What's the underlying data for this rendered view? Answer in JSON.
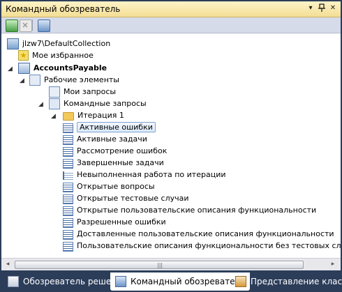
{
  "window": {
    "title": "Командный обозреватель",
    "controls": {
      "dropdown": "▾",
      "pin": "ᵖ",
      "close": "✕"
    }
  },
  "toolbar": {
    "buttons": [
      {
        "icon": "refresh-icon"
      },
      {
        "icon": "stop-icon"
      },
      {
        "icon": "connect-to-team-project-icon"
      }
    ]
  },
  "tree": {
    "server": "jlzw7\\DefaultCollection",
    "favorites": "Мое избранное",
    "project": "AccountsPayable",
    "work_items": "Рабочие элементы",
    "my_queries": "Мои запросы",
    "team_queries": "Командные запросы",
    "iteration_folder": "Итерация 1",
    "queries": [
      "Активные ошибки",
      "Активные задачи",
      "Рассмотрение ошибок",
      "Завершенные задачи",
      "Невыполненная работа по итерации",
      "Открытые вопросы",
      "Открытые тестовые случаи",
      "Открытые пользовательские описания функциональности",
      "Разрешенные ошибки",
      "Доставленные пользовательские описания функциональности",
      "Пользовательские описания функциональности без тестовых случаев"
    ],
    "selected_query": "Активные ошибки"
  },
  "scrollbar": {
    "left_arrow": "◂",
    "right_arrow": "▸",
    "grip": "|||"
  },
  "tabs": [
    {
      "label": "Обозреватель решений",
      "active": false
    },
    {
      "label": "Командный обозреватель",
      "active": true
    },
    {
      "label": "Представление классов",
      "active": false
    }
  ]
}
